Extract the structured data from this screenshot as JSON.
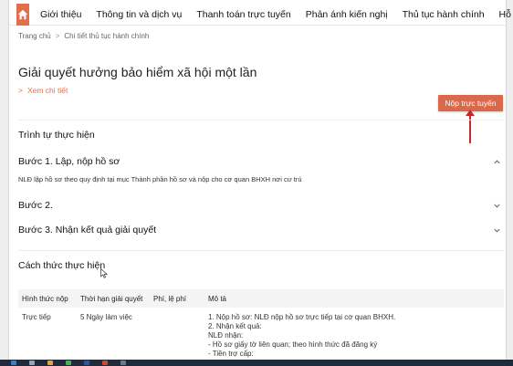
{
  "nav": {
    "items": [
      "Giới thiệu",
      "Thông tin và dịch vụ",
      "Thanh toán trực tuyến",
      "Phản ánh kiến nghị",
      "Thủ tục hành chính",
      "Hỗ trợ"
    ]
  },
  "breadcrumb": {
    "home": "Trang chủ",
    "separator": ">",
    "current": "Chi tiết thủ tục hành chính"
  },
  "page": {
    "title": "Giải quyết hưởng bảo hiểm xã hội một lần",
    "detail_link": "Xem chi tiết",
    "detail_prefix": ">",
    "submit_label": "Nộp trực tuyến"
  },
  "procedure": {
    "title": "Trình tự thực hiện",
    "steps": [
      {
        "title": "Bước 1. Lập, nộp hồ sơ",
        "desc": "NLĐ lập hồ sơ theo quy định tại mục Thành phần hồ sơ và nộp cho cơ quan BHXH nơi cư trú"
      },
      {
        "title": "Bước 2."
      },
      {
        "title": "Bước 3. Nhận kết quả giải quyết"
      }
    ]
  },
  "method": {
    "title": "Cách thức thực hiện",
    "headers": [
      "Hình thức nộp",
      "Thời hạn giải quyết",
      "Phí, lệ phí",
      "Mô tả"
    ],
    "rows": [
      {
        "form": "Trực tiếp",
        "duration": "5 Ngày làm việc",
        "fee": "",
        "desc_lines": [
          "1. Nộp hồ sơ: NLĐ nộp hồ sơ trực tiếp tại cơ quan BHXH.",
          "2. Nhận kết quả:",
          "NLĐ nhận:",
          "- Hồ sơ giấy tờ liên quan; theo hình thức đã đăng ký",
          "- Tiền trợ cấp:"
        ]
      }
    ]
  },
  "colors": {
    "accent": "#e1704a",
    "button": "#d9694a",
    "arrow": "#c62828"
  }
}
